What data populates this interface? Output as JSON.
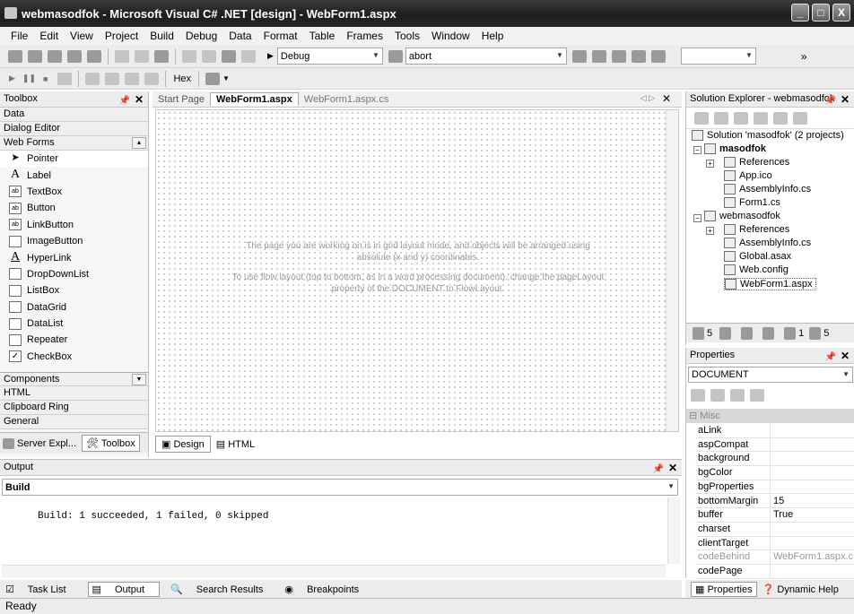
{
  "window": {
    "title": "webmasodfok - Microsoft Visual C# .NET [design] - WebForm1.aspx",
    "buttons": [
      "_",
      "□",
      "X"
    ]
  },
  "menu": [
    "File",
    "Edit",
    "View",
    "Project",
    "Build",
    "Debug",
    "Data",
    "Format",
    "Table",
    "Frames",
    "Tools",
    "Window",
    "Help"
  ],
  "toolbar": {
    "config_value": "Debug",
    "find_value": "abort",
    "hex_label": "Hex",
    "overflow": "»"
  },
  "toolbox": {
    "title": "Toolbox",
    "categories_top": [
      "Data",
      "Dialog Editor",
      "Web Forms"
    ],
    "items": [
      {
        "label": "Pointer",
        "icon": "pointer-icon"
      },
      {
        "label": "Label",
        "icon": "label-icon"
      },
      {
        "label": "TextBox",
        "icon": "textbox-icon"
      },
      {
        "label": "Button",
        "icon": "button-icon"
      },
      {
        "label": "LinkButton",
        "icon": "linkbutton-icon"
      },
      {
        "label": "ImageButton",
        "icon": "imagebutton-icon"
      },
      {
        "label": "HyperLink",
        "icon": "hyperlink-icon"
      },
      {
        "label": "DropDownList",
        "icon": "dropdownlist-icon"
      },
      {
        "label": "ListBox",
        "icon": "listbox-icon"
      },
      {
        "label": "DataGrid",
        "icon": "datagrid-icon"
      },
      {
        "label": "DataList",
        "icon": "datalist-icon"
      },
      {
        "label": "Repeater",
        "icon": "repeater-icon"
      },
      {
        "label": "CheckBox",
        "icon": "checkbox-icon"
      }
    ],
    "categories_bottom": [
      "Components",
      "HTML",
      "Clipboard Ring",
      "General"
    ],
    "tab_server": "Server Expl...",
    "tab_toolbox": "Toolbox"
  },
  "designer": {
    "tabs": [
      "Start Page",
      "WebForm1.aspx",
      "WebForm1.aspx.cs"
    ],
    "active_tab": "WebForm1.aspx",
    "hint1a": "The page you are working on is in grid layout mode, and objects will be arranged using",
    "hint1b": "absolute (x and y) coordinates.",
    "hint2a": "To use flow layout (top to bottom, as in a word processing document), change the pageLayout",
    "hint2b": "property of the DOCUMENT to FlowLayout.",
    "view_design": "Design",
    "view_html": "HTML"
  },
  "solution_explorer": {
    "title": "Solution Explorer - webmasodfok",
    "solution": "Solution 'masodfok' (2 projects)",
    "project1": "masodfok",
    "p1_items": [
      "References",
      "App.ico",
      "AssemblyInfo.cs",
      "Form1.cs"
    ],
    "project2": "webmasodfok",
    "p2_items": [
      "References",
      "AssemblyInfo.cs",
      "Global.asax",
      "Web.config",
      "WebForm1.aspx"
    ],
    "tab_counts": [
      "5",
      "1",
      "5"
    ]
  },
  "properties": {
    "title": "Properties",
    "object": "DOCUMENT",
    "category": "Misc",
    "rows": [
      {
        "k": "aLink",
        "v": ""
      },
      {
        "k": "aspCompat",
        "v": ""
      },
      {
        "k": "background",
        "v": ""
      },
      {
        "k": "bgColor",
        "v": ""
      },
      {
        "k": "bgProperties",
        "v": ""
      },
      {
        "k": "bottomMargin",
        "v": "15"
      },
      {
        "k": "buffer",
        "v": "True"
      },
      {
        "k": "charset",
        "v": ""
      },
      {
        "k": "clientTarget",
        "v": ""
      },
      {
        "k": "codeBehind",
        "v": "WebForm1.aspx.c"
      },
      {
        "k": "codePage",
        "v": ""
      }
    ],
    "tab_props": "Properties",
    "tab_help": "Dynamic Help"
  },
  "output": {
    "title": "Output",
    "source": "Build",
    "text": "Build: 1 succeeded, 1 failed, 0 skipped"
  },
  "bottom_tabs": [
    "Task List",
    "Output",
    "Search Results",
    "Breakpoints"
  ],
  "status": "Ready"
}
